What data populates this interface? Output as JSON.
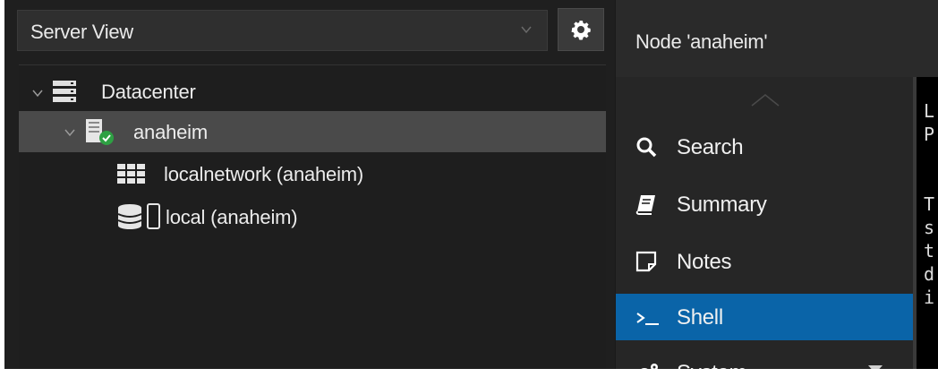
{
  "view_selector": {
    "value": "Server View"
  },
  "tree": {
    "datacenter": "Datacenter",
    "node": "anaheim",
    "network": "localnetwork (anaheim)",
    "storage": "local (anaheim)"
  },
  "node_panel": {
    "title": "Node 'anaheim'"
  },
  "nav": {
    "items": [
      {
        "label": "Search",
        "icon": "search-icon"
      },
      {
        "label": "Summary",
        "icon": "book-icon"
      },
      {
        "label": "Notes",
        "icon": "note-icon"
      },
      {
        "label": "Shell",
        "icon": "terminal-icon",
        "active": true
      },
      {
        "label": "System",
        "icon": "gears-icon"
      }
    ]
  },
  "terminal": {
    "lines": [
      "L",
      "P",
      "",
      "T",
      "s",
      "t",
      "d",
      "i"
    ]
  },
  "colors": {
    "accent": "#0a64a8",
    "selected_row": "#4a4a4a",
    "status_ok": "#2ea043"
  }
}
